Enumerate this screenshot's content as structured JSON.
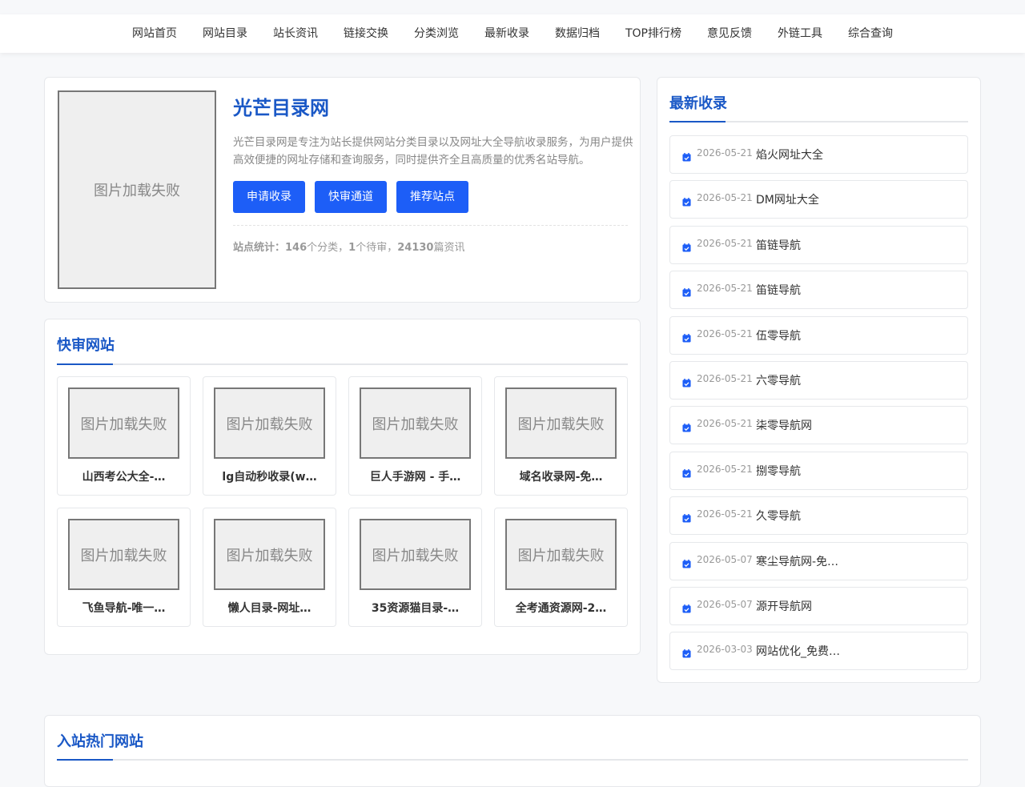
{
  "nav": {
    "items": [
      "网站首页",
      "网站目录",
      "站长资讯",
      "链接交换",
      "分类浏览",
      "最新收录",
      "数据归档",
      "TOP排行榜",
      "意见反馈",
      "外链工具",
      "综合查询"
    ]
  },
  "hero": {
    "image_alt": "图片加载失败",
    "title": "光芒目录网",
    "description": "光芒目录网是专注为站长提供网站分类目录以及网址大全导航收录服务，为用户提供高效便捷的网址存储和查询服务，同时提供齐全且高质量的优秀名站导航。",
    "buttons": [
      "申请收录",
      "快审通道",
      "推荐站点"
    ],
    "stats": {
      "label": "站点统计：",
      "categories": "146",
      "categories_unit": "个分类，",
      "pending": "1",
      "pending_unit": "个待审，",
      "articles": "24130",
      "articles_unit": "篇资讯"
    }
  },
  "fast_review": {
    "title": "快审网站",
    "image_alt": "图片加载失败",
    "items": [
      "山西考公大全-…",
      "lg自动秒收录(w…",
      "巨人手游网 - 手…",
      "域名收录网-免…",
      "飞鱼导航-唯一…",
      "懒人目录-网址…",
      "35资源猫目录-…",
      "全考通资源网-2…"
    ]
  },
  "latest": {
    "title": "最新收录",
    "icon": "calendar-check-icon",
    "items": [
      {
        "date": "2026-05-21",
        "title": "焰火网址大全"
      },
      {
        "date": "2026-05-21",
        "title": "DM网址大全"
      },
      {
        "date": "2026-05-21",
        "title": "笛链导航"
      },
      {
        "date": "2026-05-21",
        "title": "笛链导航"
      },
      {
        "date": "2026-05-21",
        "title": "伍零导航"
      },
      {
        "date": "2026-05-21",
        "title": "六零导航"
      },
      {
        "date": "2026-05-21",
        "title": "柒零导航网"
      },
      {
        "date": "2026-05-21",
        "title": "捌零导航"
      },
      {
        "date": "2026-05-21",
        "title": "久零导航"
      },
      {
        "date": "2026-05-07",
        "title": "寒尘导航网-免…"
      },
      {
        "date": "2026-05-07",
        "title": "源开导航网"
      },
      {
        "date": "2026-03-03",
        "title": "网站优化_免费…"
      }
    ]
  },
  "hot": {
    "title": "入站热门网站"
  },
  "colors": {
    "accent": "#1a58c6",
    "button": "#1d5ef7",
    "border": "#e6e8eb"
  }
}
